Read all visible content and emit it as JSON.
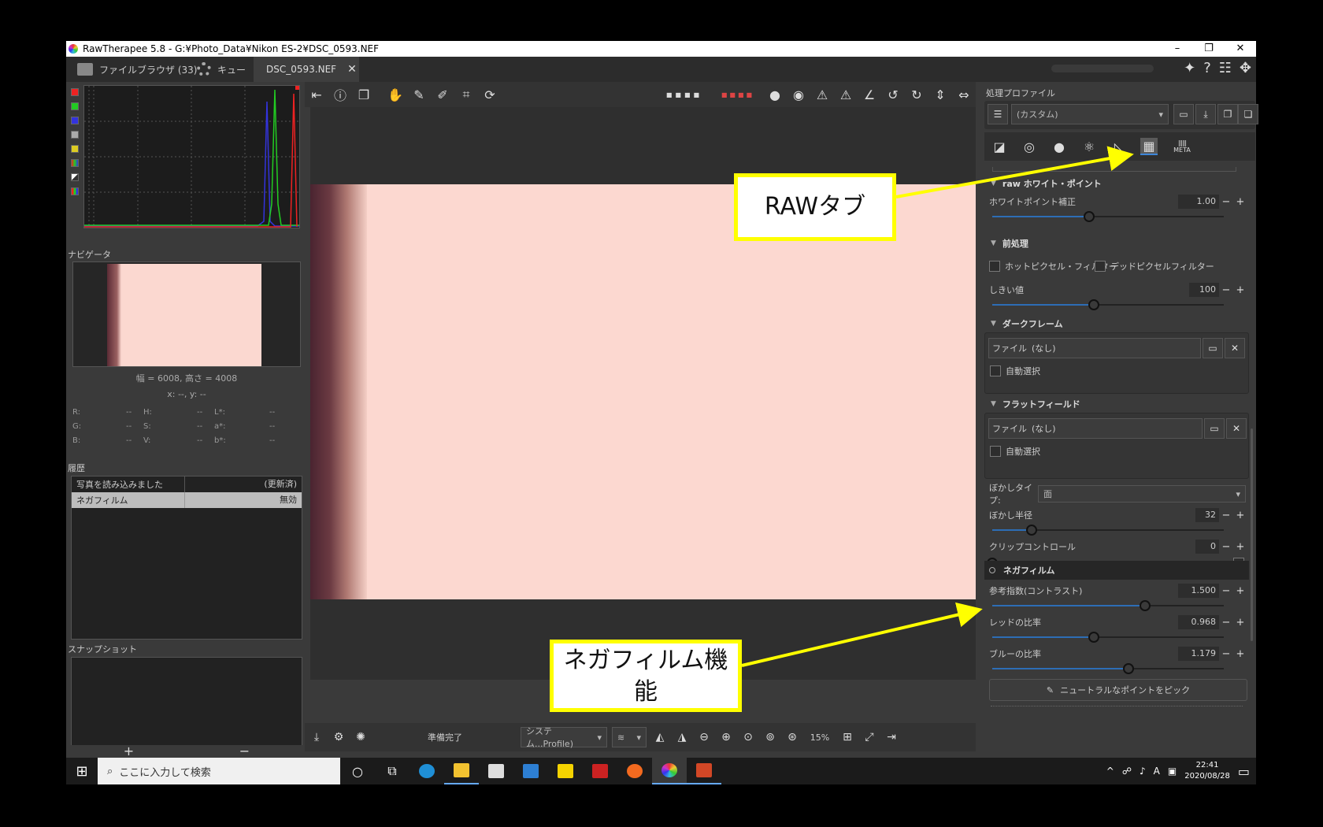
{
  "window": {
    "title": "RawTherapee 5.8 - G:¥Photo_Data¥Nikon ES-2¥DSC_0593.NEF",
    "minimize": "–",
    "restore": "❐",
    "close": "✕"
  },
  "tabs": [
    {
      "label": "ファイルブラウザ (33)"
    },
    {
      "label": "キュー"
    },
    {
      "label": "DSC_0593.NEF"
    }
  ],
  "tab_close": "✕",
  "left": {
    "navigator_title": "ナビゲータ",
    "size_text": "幅 = 6008, 高さ = 4008",
    "coord_text": "x: --, y: --",
    "readouts": [
      {
        "label": "R:",
        "value": "--"
      },
      {
        "label": "H:",
        "value": "--"
      },
      {
        "label": "L*:",
        "value": "--"
      },
      {
        "label": "G:",
        "value": "--"
      },
      {
        "label": "S:",
        "value": "--"
      },
      {
        "label": "a*:",
        "value": "--"
      },
      {
        "label": "B:",
        "value": "--"
      },
      {
        "label": "V:",
        "value": "--"
      },
      {
        "label": "b*:",
        "value": "--"
      }
    ],
    "history_title": "履歴",
    "history": [
      {
        "action": "写真を読み込みました",
        "value": "(更新済)"
      },
      {
        "action": "ネガフィルム",
        "value": "無効"
      }
    ],
    "snapshot_title": "スナップショット",
    "snapshot_add": "+",
    "snapshot_remove": "−"
  },
  "center": {
    "status": "準備完了",
    "profile_combo": "システム...Profile)",
    "zoom": "15%"
  },
  "right": {
    "profile_title": "処理プロファイル",
    "profile_value": "(カスタム)",
    "meta_label": "META",
    "sections": {
      "raw_white_point": "raw ホワイト・ポイント",
      "preprocessing": "前処理",
      "dark_frame": "ダークフレーム",
      "flat_field": "フラットフィールド",
      "film_negative": "ネガフィルム"
    },
    "white_point_label": "ホワイトポイント補正",
    "white_point_value": "1.00",
    "hot_pixel": "ホットピクセル・フィルター",
    "dead_pixel": "デッドピクセルフィルター",
    "threshold_label": "しきい値",
    "threshold_value": "100",
    "df_file_label": "ファイル",
    "df_file_value": "(なし)",
    "df_auto": "自動選択",
    "ff_file_label": "ファイル",
    "ff_file_value": "(なし)",
    "ff_auto": "自動選択",
    "blur_type_label": "ぼかしタイプ:",
    "blur_type_value": "面",
    "blur_radius_label": "ぼかし半径",
    "blur_radius_value": "32",
    "clip_label": "クリップコントロール",
    "clip_value": "0",
    "contrast_label": "参考指数(コントラスト)",
    "contrast_value": "1.500",
    "red_ratio_label": "レッドの比率",
    "red_ratio_value": "0.968",
    "blue_ratio_label": "ブルーの比率",
    "blue_ratio_value": "1.179",
    "pick_neutral": "ニュートラルなポイントをピック",
    "minus": "−",
    "plus": "+",
    "slider_positions": {
      "white_point": 0.42,
      "threshold": 0.44,
      "blur_radius": 0.17,
      "clip": 0.0,
      "contrast": 0.66,
      "red_ratio": 0.44,
      "blue_ratio": 0.59
    }
  },
  "annotations": {
    "raw_tab": "RAWタブ",
    "film_negative_feature": "ネガフィルム機能"
  },
  "taskbar": {
    "search_placeholder": "ここに入力して検索",
    "time": "22:41",
    "date": "2020/08/28",
    "ime": "A"
  },
  "colors": {
    "annotation_yellow": "#ffff00",
    "slider_blue": "#2d6db5",
    "photo_pink": "#fcd8d0"
  }
}
